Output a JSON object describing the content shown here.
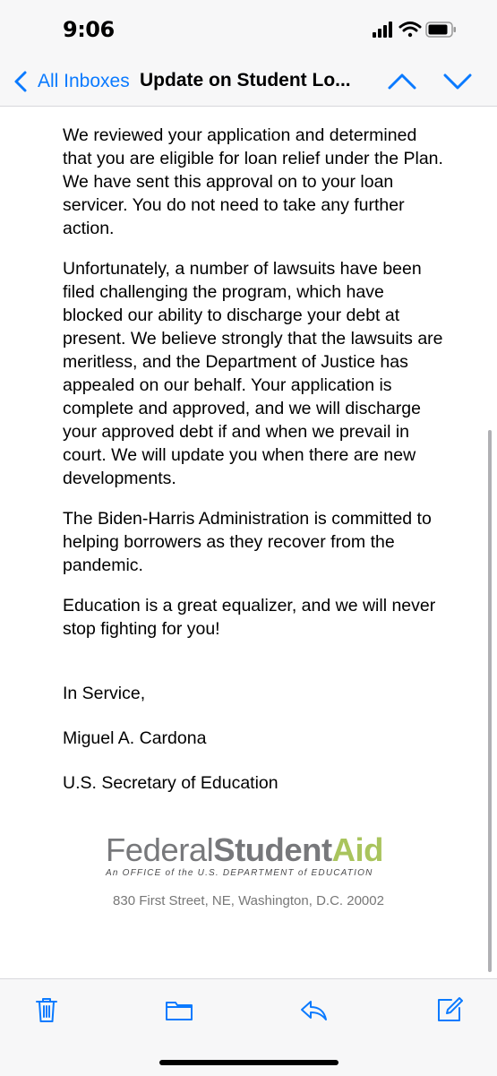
{
  "status_bar": {
    "time": "9:06"
  },
  "nav": {
    "back_label": "All Inboxes",
    "title": "Update on Student Lo..."
  },
  "body": {
    "paragraphs": [
      "We reviewed your application and determined that you are eligible for loan relief under the Plan. We have sent this approval on to your loan servicer. You do not need to take any further action.",
      "Unfortunately, a number of lawsuits have been filed challenging the program, which have blocked our ability to discharge your debt at present. We believe strongly that the lawsuits are meritless, and the Department of Justice has appealed on our behalf. Your application is complete and approved, and we will discharge your approved debt if and when we prevail in court. We will update you when there are new developments.",
      "The Biden-Harris Administration is committed to helping borrowers as they recover from the pandemic.",
      "Education is a great equalizer, and we will never stop fighting for you!"
    ],
    "closing": "In Service,",
    "signer_name": "Miguel A. Cardona",
    "signer_title": "U.S. Secretary of Education"
  },
  "footer": {
    "logo_word1": "Federal",
    "logo_word2": "Student",
    "logo_word3": "Aid",
    "tagline": "An OFFICE of the U.S. DEPARTMENT of EDUCATION",
    "address": "830 First Street, NE, Washington, D.C. 20002"
  },
  "icons": {
    "back": "chevron-left-icon",
    "prev": "chevron-up-icon",
    "next": "chevron-down-icon",
    "trash": "trash-icon",
    "folder": "folder-icon",
    "reply": "reply-icon",
    "compose": "compose-icon"
  },
  "colors": {
    "accent": "#0a7aff",
    "logo_gray": "#77787b",
    "logo_green": "#a9c45d"
  }
}
